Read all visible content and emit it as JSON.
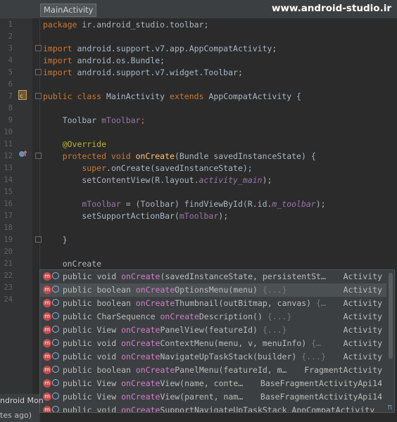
{
  "tab": {
    "label": "MainActivity"
  },
  "watermark": "www.android-studio.ir",
  "line_numbers": [
    "1",
    "2",
    "3",
    "4",
    "5",
    "6",
    "7",
    "8",
    "9",
    "10",
    "11",
    "12",
    "13",
    "14",
    "15",
    "16",
    "17",
    "18",
    "19",
    "20",
    "21",
    "22",
    "23",
    "24"
  ],
  "code": {
    "l1_kw": "package",
    "l1_rest": " ir.android_studio.toolbar;",
    "l3_kw": "import",
    "l3_rest": " android.support.v7.app.AppCompatActivity;",
    "l4_kw": "import",
    "l4_rest": " android.os.Bundle;",
    "l5_kw": "import",
    "l5_rest": " android.support.v7.widget.Toolbar;",
    "l7_kw1": "public class",
    "l7_name": " MainActivity ",
    "l7_kw2": "extends",
    "l7_rest": " AppCompatActivity {",
    "l9_type": "    Toolbar ",
    "l9_field": "mToolbar",
    "l9_end": ";",
    "l11_ann": "    @Override",
    "l12_kw": "    protected void ",
    "l12_fn": "onCreate",
    "l12_rest": "(Bundle savedInstanceState) {",
    "l13_kw": "        super",
    "l13_rest": ".onCreate(savedInstanceState);",
    "l14_a": "        setContentView(R.layout.",
    "l14_it": "activity_main",
    "l14_b": ");",
    "l16_field": "        mToolbar",
    "l16_a": " = (Toolbar) findViewById(R.id.",
    "l16_it": "m_toolbar",
    "l16_b": ");",
    "l17_a": "        setSupportActionBar(",
    "l17_field": "mToolbar",
    "l17_b": ");",
    "l19": "    }",
    "l21": "    onCreate"
  },
  "completion": {
    "items": [
      {
        "pre": "public void ",
        "match": "onCreate",
        "post": "(savedInstanceState, persistentSt…",
        "dim": "",
        "type": "Activity"
      },
      {
        "pre": "public boolean ",
        "match": "onCreate",
        "post": "OptionsMenu(menu) ",
        "dim": "{...}",
        "type": "Activity"
      },
      {
        "pre": "public boolean ",
        "match": "onCreate",
        "post": "Thumbnail(outBitmap, canvas) ",
        "dim": "{…",
        "type": "Activity"
      },
      {
        "pre": "public CharSequence ",
        "match": "onCreate",
        "post": "Description() ",
        "dim": "{...}",
        "type": "Activity"
      },
      {
        "pre": "public View ",
        "match": "onCreate",
        "post": "PanelView(featureId) ",
        "dim": "{...}",
        "type": "Activity"
      },
      {
        "pre": "public void ",
        "match": "onCreate",
        "post": "ContextMenu(menu, v, menuInfo) ",
        "dim": "{…",
        "type": "Activity"
      },
      {
        "pre": "public void ",
        "match": "onCreate",
        "post": "NavigateUpTaskStack(builder) ",
        "dim": "{...}",
        "type": "Activity"
      },
      {
        "pre": "public boolean ",
        "match": "onCreate",
        "post": "PanelMenu(featureId, m…",
        "dim": "",
        "type": "FragmentActivity"
      },
      {
        "pre": "public View ",
        "match": "onCreate",
        "post": "View(name, conte…",
        "dim": "",
        "type": "BaseFragmentActivityApi14"
      },
      {
        "pre": "public View ",
        "match": "onCreate",
        "post": "View(parent, nam…",
        "dim": "",
        "type": "BaseFragmentActivityApi14"
      },
      {
        "pre": "public void ",
        "match": "onCreate",
        "post": "SupportNavigateUpTaskStack AppCompatActivity",
        "dim": "",
        "type": ""
      }
    ],
    "icon_letter": "m",
    "pi": "π"
  },
  "bottom": {
    "line1": "ndroid Mon",
    "line2": "tes ago)"
  }
}
